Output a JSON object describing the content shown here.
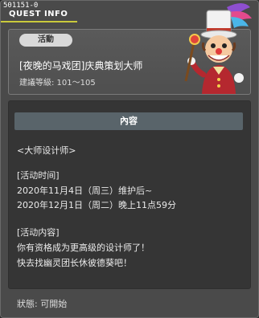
{
  "window": {
    "quest_id": "501151-0",
    "title": "QUEST INFO"
  },
  "header": {
    "badge": "活動",
    "quest_name": "[夜晚的马戏团]庆典策划大师",
    "level": "建議等級: 101～105"
  },
  "content": {
    "section_title": "內容",
    "lines": [
      "<大师设计师>",
      "",
      "[活动时间]",
      "2020年11月4日（周三）维护后~",
      "2020年12月1日（周二）晚上11点59分",
      "",
      "[活动内容]",
      "你有资格成为更高级的设计师了！",
      "快去找幽灵团长休彼德葵吧！"
    ]
  },
  "footer": {
    "status": "狀態:  可開始"
  },
  "colors": {
    "accent_underline": "#c9c93b",
    "section_header": "#59646a"
  }
}
